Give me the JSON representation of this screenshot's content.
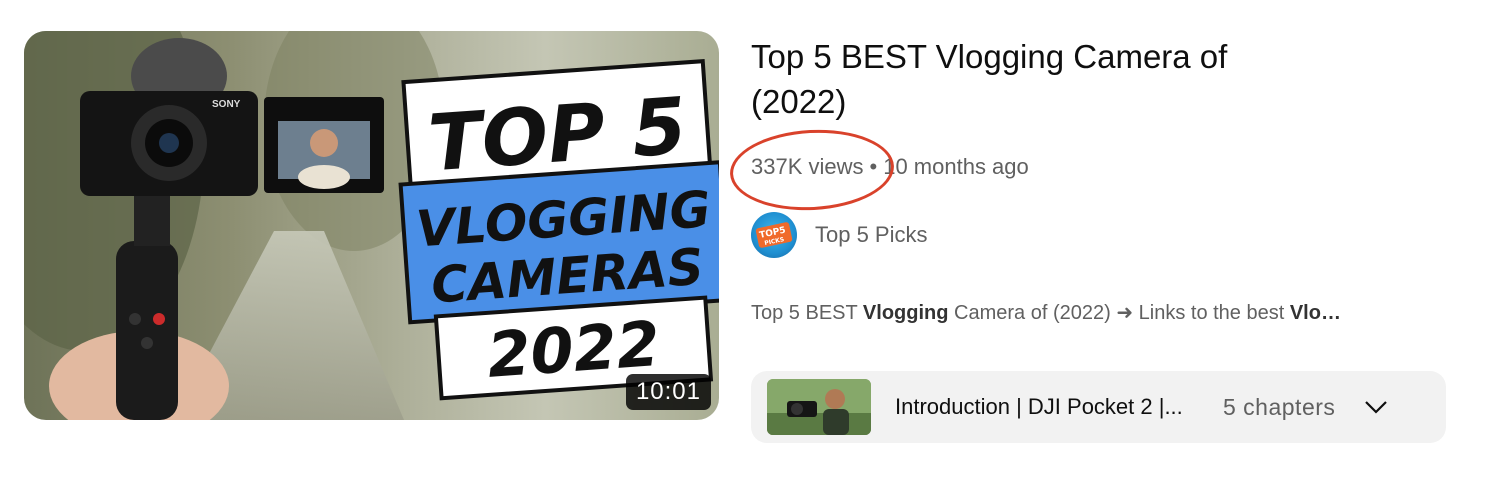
{
  "video": {
    "title": "Top 5 BEST Vlogging Camera of (2022)",
    "duration": "10:01",
    "views": "337K views",
    "separator": "•",
    "age": "10 months ago",
    "thumbnail": {
      "line1": "TOP 5",
      "line2": "VLOGGING",
      "line3": "CAMERAS",
      "line4": "2022",
      "camera_brand": "SONY"
    }
  },
  "channel": {
    "name": "Top 5 Picks",
    "avatar_text_top": "TOP5",
    "avatar_text_bottom": "PICKS"
  },
  "description": {
    "part1": "Top 5 BEST ",
    "bold1": "Vlogging",
    "part2": " Camera of (2022) ➜ Links to the best ",
    "bold2": "Vlo…"
  },
  "chapters": {
    "current_title": "Introduction | DJI Pocket 2 |...",
    "count": "5 chapters"
  },
  "colors": {
    "annotation": "#d9422b",
    "badge_blue": "#4a8fe7",
    "meta_text": "#606060"
  }
}
